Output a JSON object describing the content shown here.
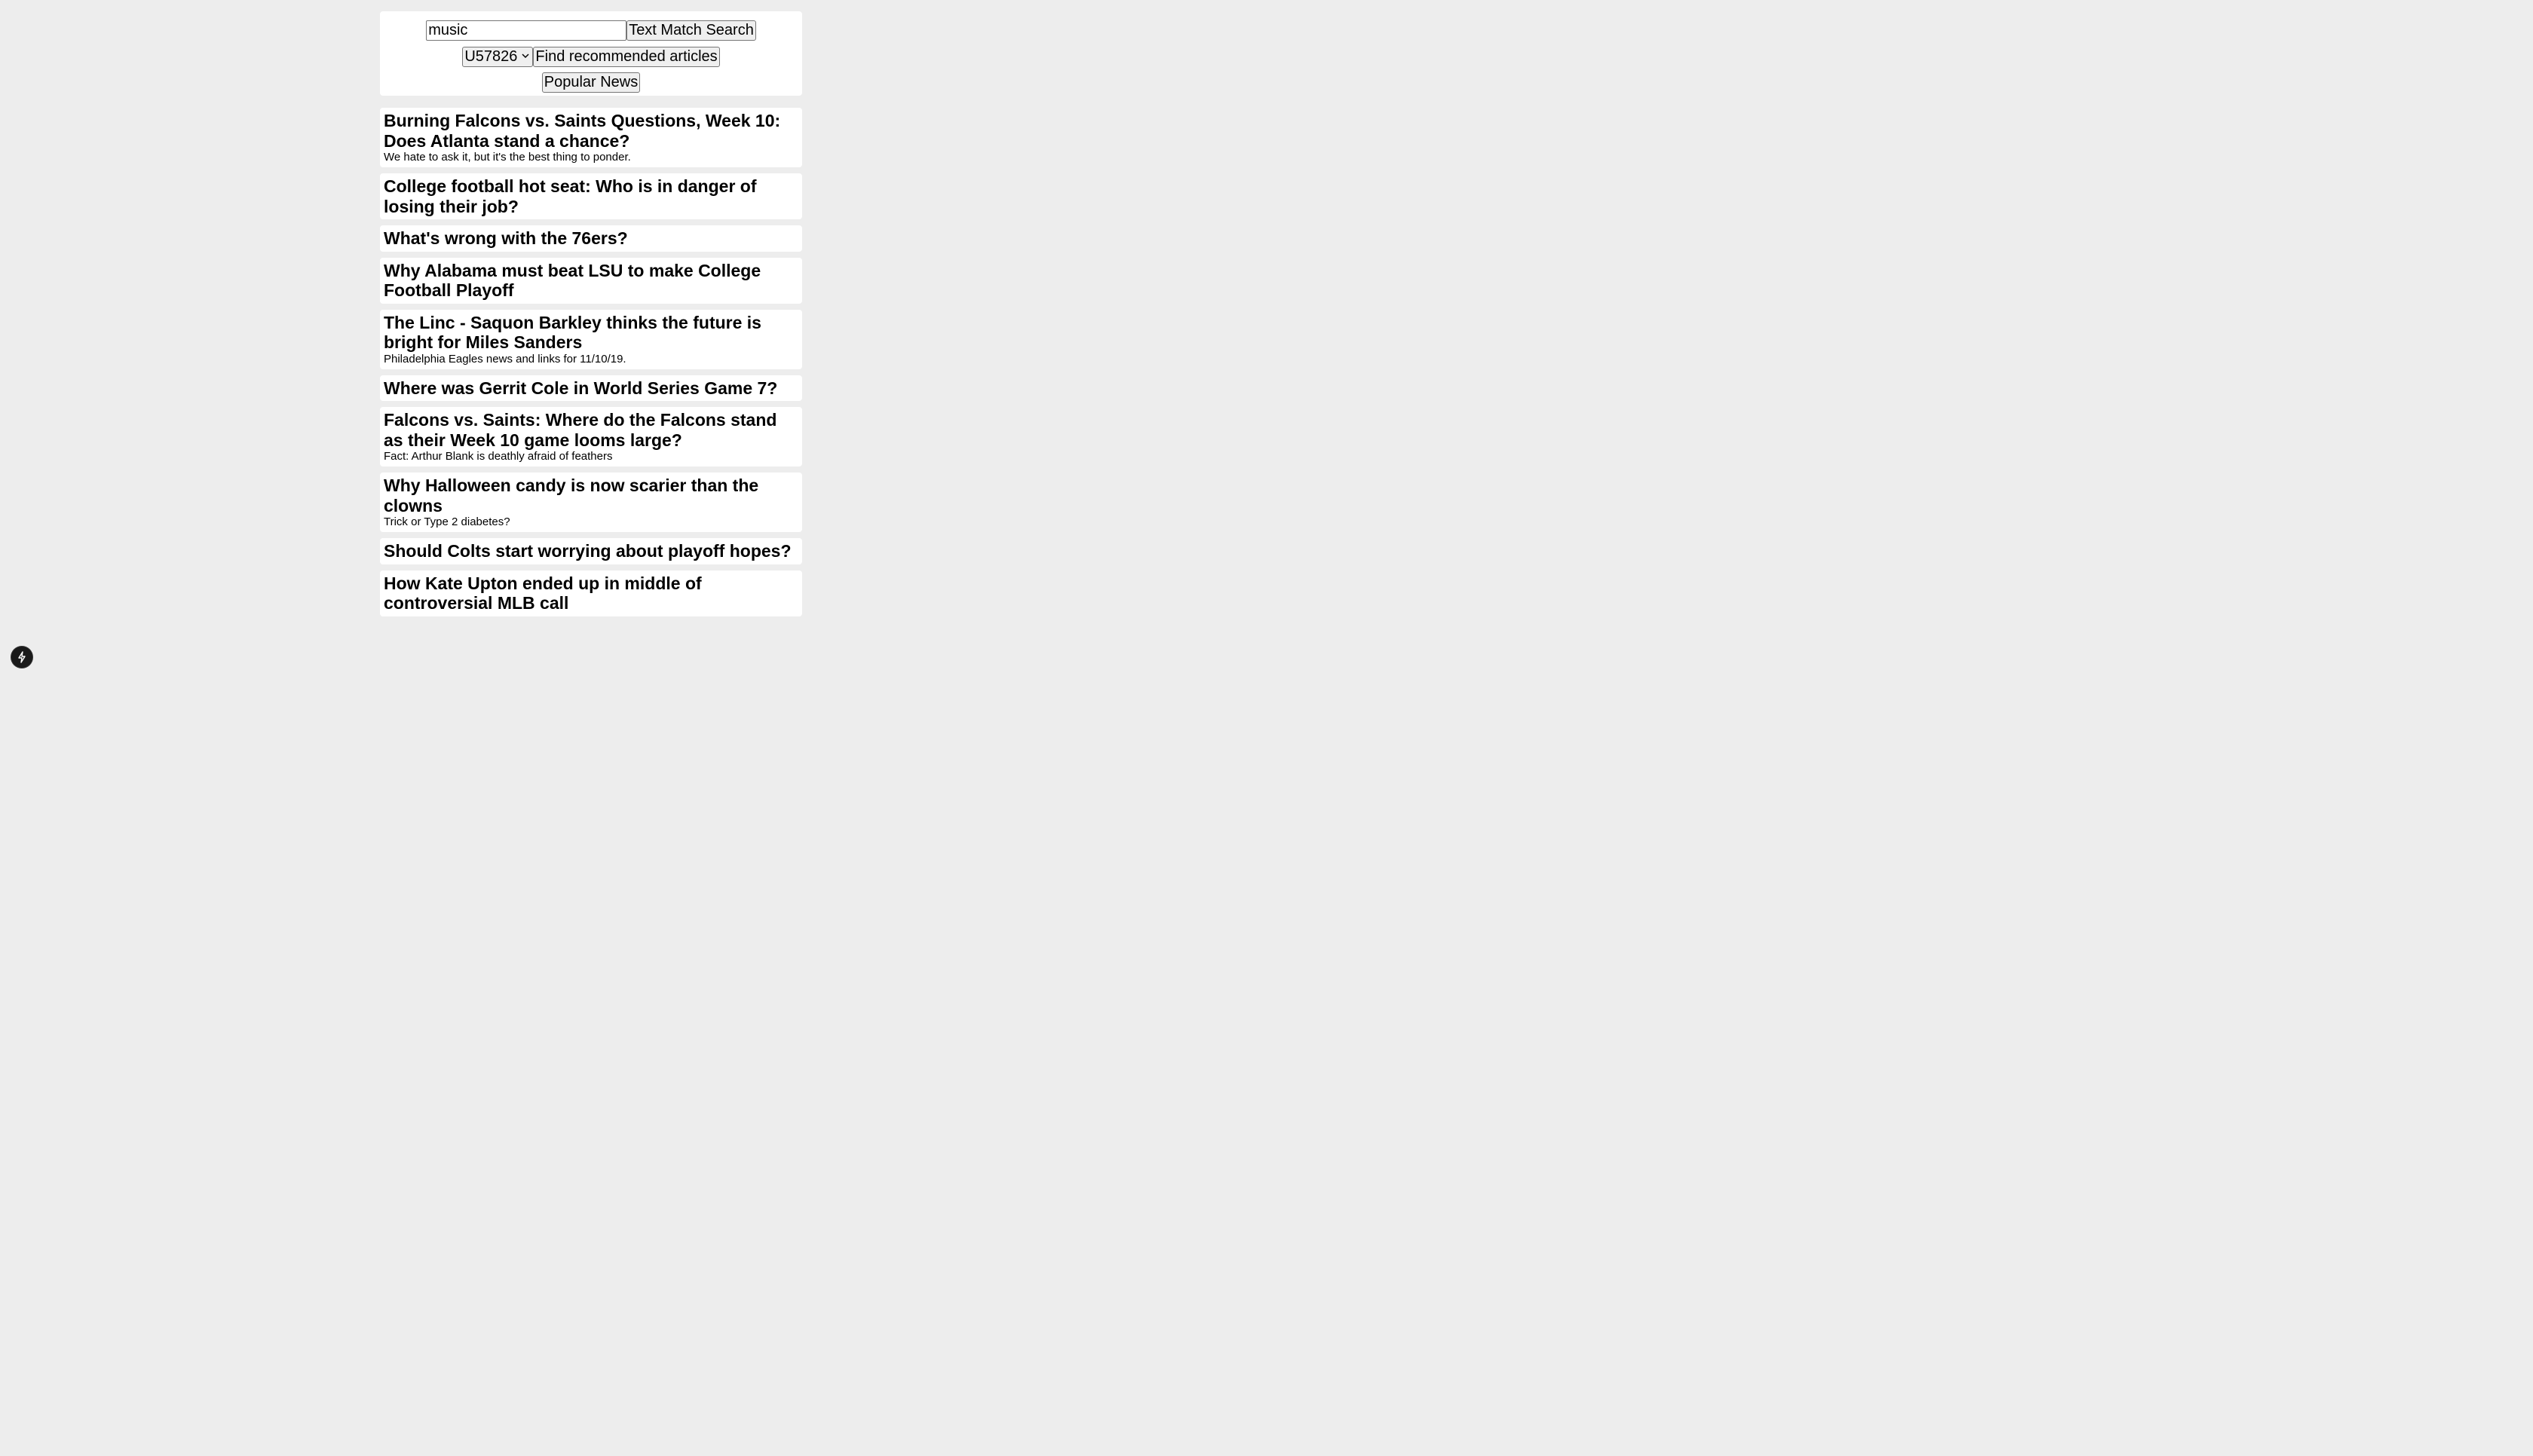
{
  "search": {
    "query": "music",
    "button_label": "Text Match Search"
  },
  "recommend": {
    "selected_user": "U57826",
    "button_label": "Find recommended articles"
  },
  "popular": {
    "button_label": "Popular News"
  },
  "articles": [
    {
      "title": "Burning Falcons vs. Saints Questions, Week 10: Does Atlanta stand a chance?",
      "abstract": "We hate to ask it, but it's the best thing to ponder."
    },
    {
      "title": "College football hot seat: Who is in danger of losing their job?",
      "abstract": ""
    },
    {
      "title": "What's wrong with the 76ers?",
      "abstract": ""
    },
    {
      "title": "Why Alabama must beat LSU to make College Football Playoff",
      "abstract": ""
    },
    {
      "title": "The Linc - Saquon Barkley thinks the future is bright for Miles Sanders",
      "abstract": "Philadelphia Eagles news and links for 11/10/19."
    },
    {
      "title": "Where was Gerrit Cole in World Series Game 7?",
      "abstract": ""
    },
    {
      "title": "Falcons vs. Saints: Where do the Falcons stand as their Week 10 game looms large?",
      "abstract": "Fact: Arthur Blank is deathly afraid of feathers"
    },
    {
      "title": "Why Halloween candy is now scarier than the clowns",
      "abstract": "Trick or Type 2 diabetes?"
    },
    {
      "title": "Should Colts start worrying about playoff hopes?",
      "abstract": ""
    },
    {
      "title": "How Kate Upton ended up in middle of controversial MLB call",
      "abstract": ""
    }
  ],
  "badge": {
    "icon": "lightning-bolt-icon"
  }
}
